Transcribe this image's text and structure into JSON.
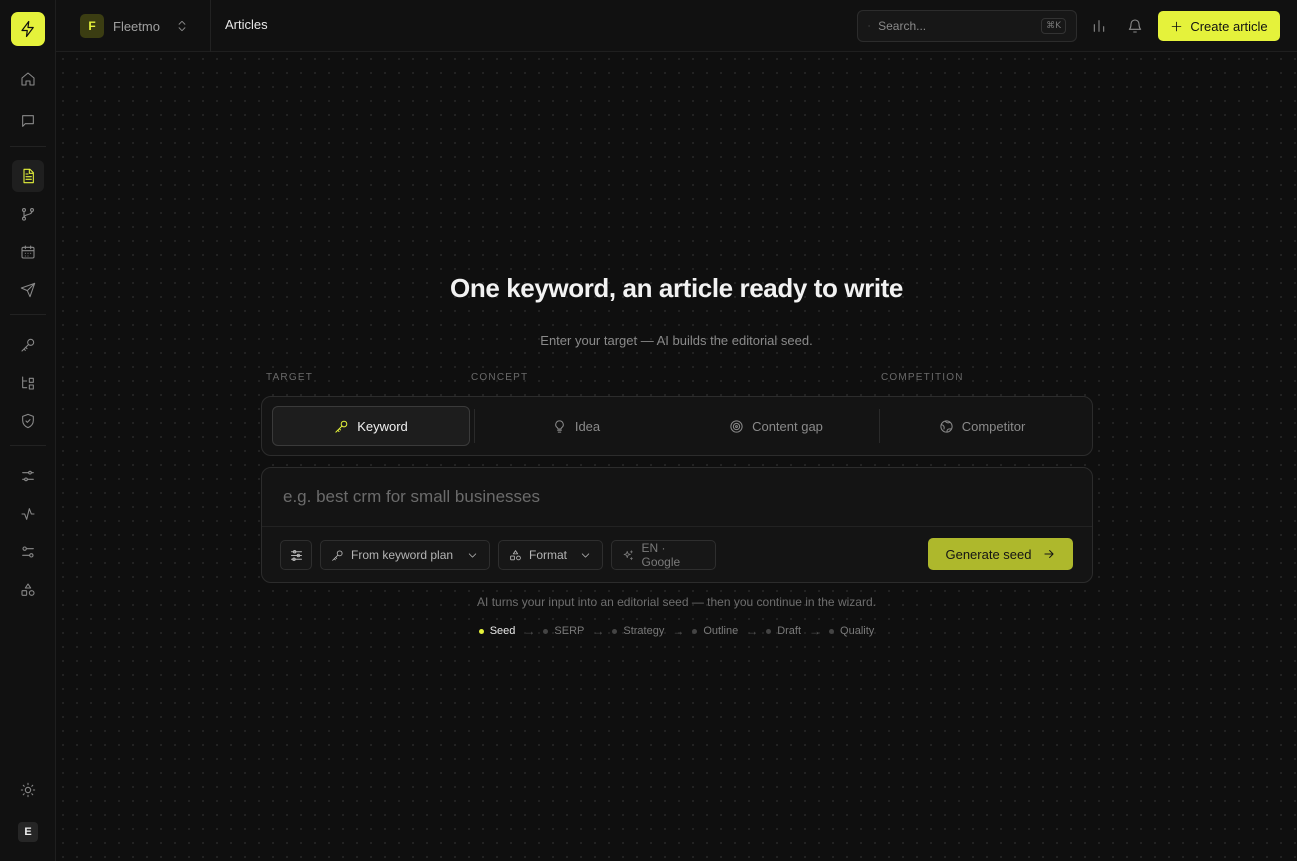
{
  "app": {
    "name": "Fleetmo",
    "initial": "F",
    "user_initial": "E"
  },
  "topbar": {
    "page_title": "Articles",
    "search_placeholder": "Search...",
    "search_shortcut": "⌘K",
    "create_button": "Create article"
  },
  "hero": {
    "title": "One keyword, an article ready to write",
    "subtitle": "Enter your target — AI builds the editorial seed."
  },
  "groups": [
    "TARGET",
    "CONCEPT",
    "COMPETITION"
  ],
  "tabs": [
    {
      "label": "Keyword",
      "icon": "key-icon",
      "active": true
    },
    {
      "label": "Idea",
      "icon": "lightbulb-icon",
      "active": false
    },
    {
      "label": "Content gap",
      "icon": "target-icon",
      "active": false
    },
    {
      "label": "Competitor",
      "icon": "globe-icon",
      "active": false
    }
  ],
  "input": {
    "placeholder": "e.g. best crm for small businesses",
    "value": ""
  },
  "controls": {
    "keyword_plan": "From keyword plan",
    "format": "Format",
    "locale": "EN · Google",
    "generate": "Generate seed"
  },
  "helper_text": "AI turns your input into an editorial seed — then you continue in the wizard.",
  "steps": [
    "Seed",
    "SERP",
    "Strategy",
    "Outline",
    "Draft",
    "Quality"
  ],
  "active_step": "Seed",
  "colors": {
    "accent": "#e5f23b",
    "background": "#0f0f0f",
    "panel": "#141414"
  }
}
